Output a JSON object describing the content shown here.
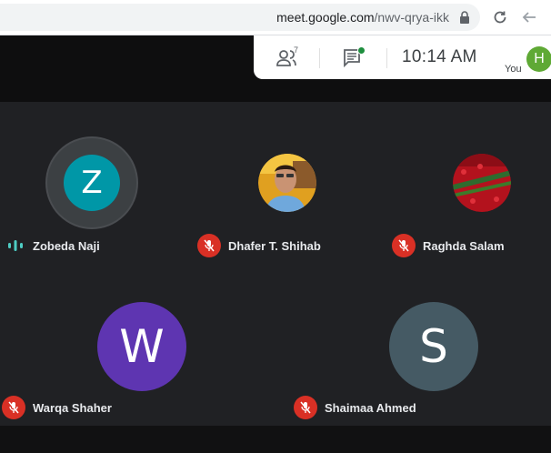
{
  "browser": {
    "url": "meet.google.com/nwv-qrya-ikk",
    "url_host": "meet.google.com",
    "url_path": "/nwv-qrya-ikk"
  },
  "meeting_panel": {
    "participant_count": "7",
    "time": "10:14  AM",
    "you_label": "You",
    "you_initial": "H",
    "icons": [
      "people-icon",
      "chat-icon"
    ]
  },
  "participants": [
    {
      "name": "Zobeda Naji",
      "initial": "Z",
      "status": "speaking",
      "color": "#0097a7"
    },
    {
      "name": "Dhafer T. Shihab",
      "status": "muted",
      "photo": true
    },
    {
      "name": "Raghda Salam",
      "status": "muted",
      "photo": true
    },
    {
      "name": "Warqa Shaher",
      "initial": "W",
      "status": "muted",
      "color": "#5e35b1"
    },
    {
      "name": "Shaimaa Ahmed",
      "initial": "S",
      "status": "muted",
      "color": "#455a64"
    }
  ],
  "colors": {
    "mute": "#d93025",
    "speaking": "#4ecdc4",
    "you_avatar": "#5fa935"
  }
}
